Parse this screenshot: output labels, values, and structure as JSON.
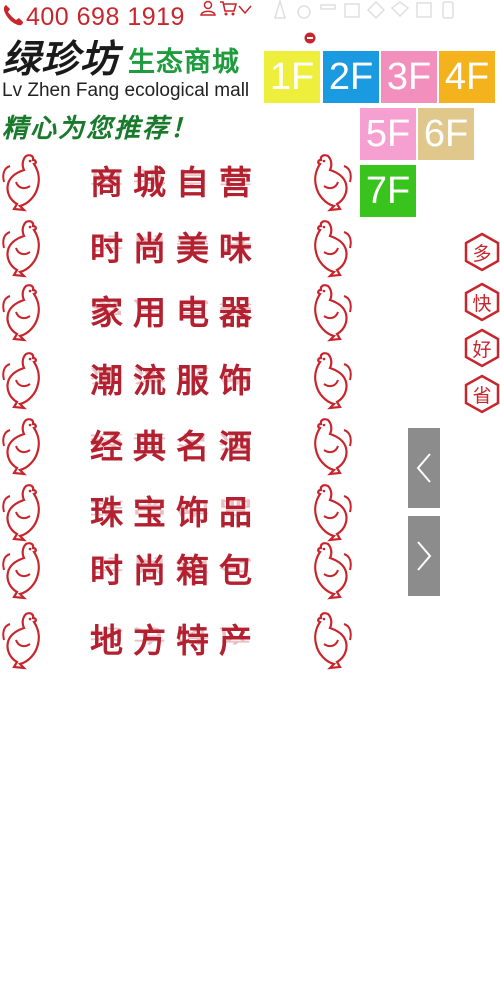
{
  "header": {
    "hotline": "400 698 1919",
    "icons": [
      "phone-icon",
      "user-icon",
      "cart-icon",
      "chevron-down-icon"
    ],
    "toolbar_icons": [
      "glasses-icon",
      "ring-icon",
      "bottle-icon",
      "hanger-icon",
      "diamond-icon",
      "phone-device-icon",
      "box-icon",
      "bag-icon"
    ]
  },
  "logo": {
    "name_cn": "绿珍坊",
    "subtitle": "生态商城",
    "name_en": "Lv Zhen Fang ecological mall",
    "slogan": "精心为您推荐！"
  },
  "floors": [
    {
      "label": "1F",
      "color": "#eeee3c"
    },
    {
      "label": "2F",
      "color": "#1a9ae0"
    },
    {
      "label": "3F",
      "color": "#f38fbc"
    },
    {
      "label": "4F",
      "color": "#f4b21c"
    },
    {
      "label": "5F",
      "color": "#f6a0d2"
    },
    {
      "label": "6F",
      "color": "#e0c88c"
    },
    {
      "label": "7F",
      "color": "#38c41c"
    }
  ],
  "categories": [
    {
      "label": "商城自营"
    },
    {
      "label": "时尚美味"
    },
    {
      "label": "家用电器"
    },
    {
      "label": "潮流服饰"
    },
    {
      "label": "经典名酒"
    },
    {
      "label": "珠宝饰品"
    },
    {
      "label": "时尚箱包"
    },
    {
      "label": "地方特产"
    }
  ],
  "badges": [
    "多",
    "快",
    "好",
    "省"
  ],
  "colors": {
    "brand_red": "#b3202f",
    "brand_green": "#1e9c3e",
    "arrow_bg": "#8c8c8c"
  }
}
